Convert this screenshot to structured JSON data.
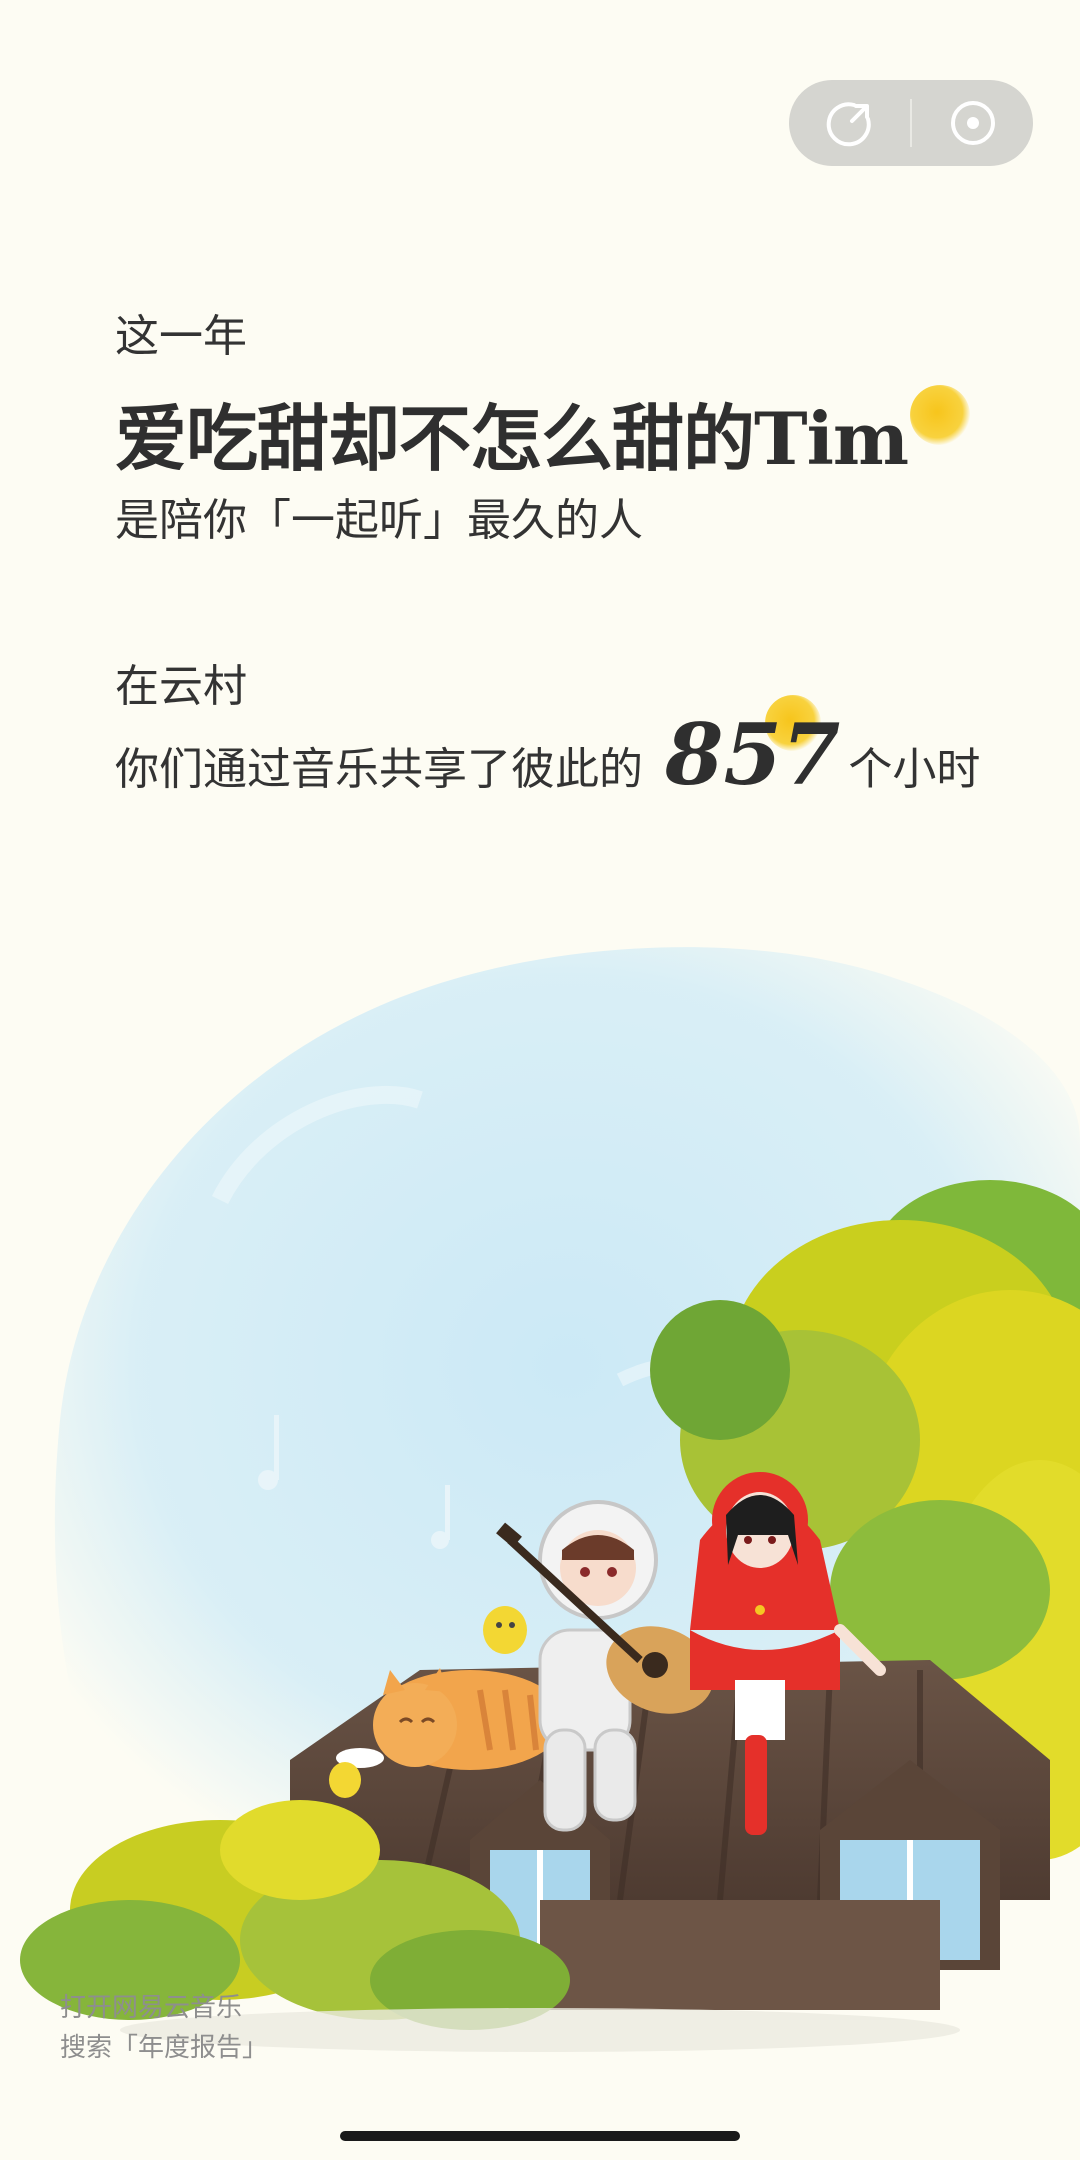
{
  "capsule": {
    "share_icon": "share-arrow-icon",
    "close_icon": "target-circle-icon"
  },
  "report": {
    "intro": "这一年",
    "friend_name": "爱吃甜却不怎么甜的Tim",
    "subtitle": "是陪你「一起听」最久的人",
    "place": "在云村",
    "hours_prefix": "你们通过音乐共享了彼此的",
    "hours_value": "857",
    "hours_suffix": "个小时"
  },
  "footer": {
    "line1": "打开网易云音乐",
    "line2": "搜索「年度报告」"
  },
  "colors": {
    "background": "#fdfcf3",
    "accent_sun": "#f7c51c",
    "text": "#333333",
    "sky": "#cfe9f4",
    "foliage": "#d8d420"
  }
}
